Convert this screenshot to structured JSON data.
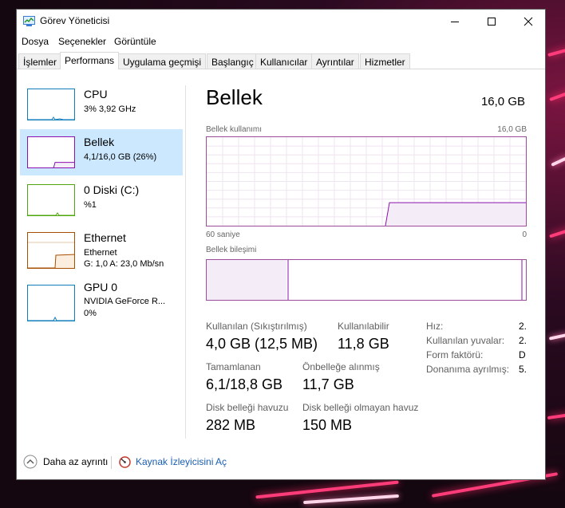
{
  "window": {
    "title": "Görev Yöneticisi"
  },
  "menu": [
    "Dosya",
    "Seçenekler",
    "Görüntüle"
  ],
  "tabs": [
    "İşlemler",
    "Performans",
    "Uygulama geçmişi",
    "Başlangıç",
    "Kullanıcılar",
    "Ayrıntılar",
    "Hizmetler"
  ],
  "active_tab": "Performans",
  "sidebar": [
    {
      "title": "CPU",
      "lines": [
        "3%  3,92 GHz"
      ],
      "color": "#117dbb"
    },
    {
      "title": "Bellek",
      "lines": [
        "4,1/16,0 GB (26%)"
      ],
      "color": "#8b12ae",
      "level": 0.26
    },
    {
      "title": "0 Diski (C:)",
      "lines": [
        "%1"
      ],
      "color": "#4da60c"
    },
    {
      "title": "Ethernet",
      "lines": [
        "Ethernet",
        "G: 1,0  A: 23,0 Mb/sn"
      ],
      "color": "#a74f01"
    },
    {
      "title": "GPU 0",
      "lines": [
        "NVIDIA GeForce R...",
        "0%"
      ],
      "color": "#117dbb"
    }
  ],
  "main": {
    "title": "Bellek",
    "total": "16,0 GB",
    "graph_label": "Bellek kullanımı",
    "graph_max": "16,0 GB",
    "graph_time": "60 saniye",
    "graph_min": "0",
    "composition_label": "Bellek bileşimi",
    "usage_fraction": 0.26,
    "composition": {
      "used_fraction": 0.25,
      "standby_end": 0.995
    }
  },
  "stats": {
    "in_use_label": "Kullanılan (Sıkıştırılmış)",
    "in_use_value": "4,0 GB (12,5 MB)",
    "available_label": "Kullanılabilir",
    "available_value": "11,8 GB",
    "committed_label": "Tamamlanan",
    "committed_value": "6,1/18,8 GB",
    "cached_label": "Önbelleğe alınmış",
    "cached_value": "11,7 GB",
    "paged_label": "Disk belleği havuzu",
    "paged_value": "282 MB",
    "nonpaged_label": "Disk belleği olmayan havuz",
    "nonpaged_value": "150 MB"
  },
  "kv": [
    {
      "label": "Hız:",
      "value": "2."
    },
    {
      "label": "Kullanılan yuvalar:",
      "value": "2."
    },
    {
      "label": "Form faktörü:",
      "value": "D"
    },
    {
      "label": "Donanıma ayrılmış:",
      "value": "5."
    }
  ],
  "footer": {
    "less_details": "Daha az ayrıntı",
    "resource_monitor": "Kaynak İzleyicisini Aç"
  },
  "colors": {
    "memory": "#8b12ae",
    "selected": "#cce8ff"
  }
}
